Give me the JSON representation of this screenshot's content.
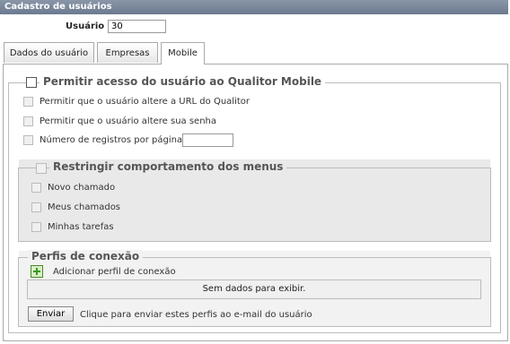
{
  "window": {
    "title": "Cadastro de usuários"
  },
  "user": {
    "label": "Usuário :",
    "value": "30"
  },
  "tabs": [
    {
      "label": "Dados do usuário"
    },
    {
      "label": "Empresas"
    },
    {
      "label": "Mobile"
    }
  ],
  "mobile": {
    "legend": "Permitir acesso do usuário ao Qualitor Mobile",
    "options": [
      {
        "label": "Permitir que o usuário altere a URL do Qualitor"
      },
      {
        "label": "Permitir que o usuário altere sua senha"
      },
      {
        "label": "Número de registros por página"
      }
    ],
    "records_per_page": ""
  },
  "menus": {
    "legend": "Restringir comportamento dos menus",
    "items": [
      {
        "label": "Novo chamado"
      },
      {
        "label": "Meus chamados"
      },
      {
        "label": "Minhas tarefas"
      }
    ]
  },
  "profiles": {
    "legend": "Perfis de conexão",
    "add_label": "Adicionar perfil de conexão",
    "empty_text": "Sem dados para exibir.",
    "send_button": "Enviar",
    "send_hint": "Clique para enviar estes perfis ao e-mail do usuário"
  }
}
